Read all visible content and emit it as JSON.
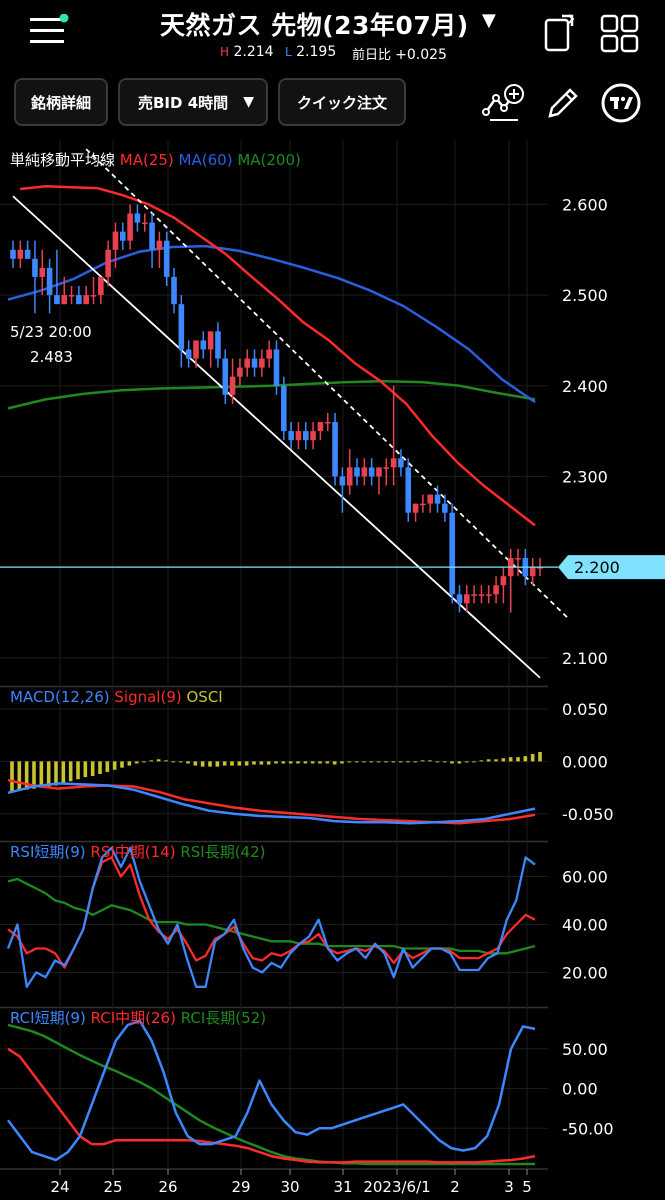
{
  "header": {
    "title": "天然ガス 先物(23年07月)",
    "high_label": "H",
    "high": "2.214",
    "low_label": "L",
    "low": "2.195",
    "change_label": "前日比",
    "change": "+0.025"
  },
  "toolbar": {
    "details_label": "銘柄詳細",
    "bid_label": "売BID 4時間",
    "quick_order_label": "クイック注文"
  },
  "icons": [
    "menu-icon",
    "rotate-screen-icon",
    "grid-icon",
    "add-drawing-icon",
    "pencil-icon",
    "tradingview-icon",
    "dropdown-caret-icon"
  ],
  "colors": {
    "up": "#e8414f",
    "down": "#3d87ff",
    "ma25": "#ff2a2a",
    "ma60": "#2a5fe0",
    "ma200": "#1e8a1e",
    "price_line": "#7fe3ff",
    "osci": "#c9c42d"
  },
  "chart_data": [
    {
      "type": "candlestick",
      "legend": [
        {
          "name": "単純移動平均線",
          "color": "#ffffff"
        },
        {
          "name": "MA(25)",
          "color": "#ff2a2a"
        },
        {
          "name": "MA(60)",
          "color": "#2a5fe0"
        },
        {
          "name": "MA(200)",
          "color": "#1e8a1e"
        }
      ],
      "annotation": {
        "date": "5/23 20:00",
        "value": "2.483"
      },
      "current_price": "2.200",
      "yticks": [
        "2.600",
        "2.500",
        "2.400",
        "2.300",
        "2.200",
        "2.100"
      ],
      "ylim": [
        2.07,
        2.66
      ],
      "xticks": [
        "24",
        "25",
        "26",
        "29",
        "30",
        "31",
        "2023/6/1",
        "2",
        "3",
        "5"
      ],
      "candles": [
        [
          2.55,
          2.56,
          2.53,
          2.54
        ],
        [
          2.54,
          2.56,
          2.53,
          2.55
        ],
        [
          2.55,
          2.56,
          2.54,
          2.54
        ],
        [
          2.54,
          2.56,
          2.48,
          2.52
        ],
        [
          2.52,
          2.55,
          2.5,
          2.53
        ],
        [
          2.53,
          2.54,
          2.48,
          2.5
        ],
        [
          2.5,
          2.55,
          2.49,
          2.49
        ],
        [
          2.49,
          2.52,
          2.49,
          2.5
        ],
        [
          2.5,
          2.51,
          2.49,
          2.5
        ],
        [
          2.5,
          2.51,
          2.49,
          2.49
        ],
        [
          2.49,
          2.51,
          2.49,
          2.5
        ],
        [
          2.5,
          2.52,
          2.49,
          2.5
        ],
        [
          2.5,
          2.52,
          2.49,
          2.52
        ],
        [
          2.52,
          2.56,
          2.51,
          2.55
        ],
        [
          2.55,
          2.58,
          2.53,
          2.57
        ],
        [
          2.57,
          2.58,
          2.55,
          2.56
        ],
        [
          2.56,
          2.6,
          2.55,
          2.59
        ],
        [
          2.59,
          2.6,
          2.57,
          2.58
        ],
        [
          2.58,
          2.59,
          2.57,
          2.58
        ],
        [
          2.58,
          2.59,
          2.53,
          2.55
        ],
        [
          2.55,
          2.57,
          2.53,
          2.56
        ],
        [
          2.56,
          2.57,
          2.51,
          2.52
        ],
        [
          2.52,
          2.53,
          2.48,
          2.49
        ],
        [
          2.49,
          2.5,
          2.42,
          2.44
        ],
        [
          2.44,
          2.45,
          2.42,
          2.43
        ],
        [
          2.43,
          2.45,
          2.42,
          2.45
        ],
        [
          2.45,
          2.46,
          2.43,
          2.44
        ],
        [
          2.44,
          2.46,
          2.42,
          2.46
        ],
        [
          2.46,
          2.47,
          2.42,
          2.43
        ],
        [
          2.43,
          2.44,
          2.38,
          2.39
        ],
        [
          2.39,
          2.43,
          2.38,
          2.41
        ],
        [
          2.41,
          2.43,
          2.4,
          2.42
        ],
        [
          2.42,
          2.44,
          2.41,
          2.43
        ],
        [
          2.43,
          2.44,
          2.41,
          2.42
        ],
        [
          2.42,
          2.44,
          2.41,
          2.43
        ],
        [
          2.43,
          2.45,
          2.42,
          2.44
        ],
        [
          2.44,
          2.45,
          2.39,
          2.4
        ],
        [
          2.4,
          2.41,
          2.34,
          2.35
        ],
        [
          2.35,
          2.36,
          2.33,
          2.34
        ],
        [
          2.34,
          2.36,
          2.33,
          2.35
        ],
        [
          2.35,
          2.36,
          2.33,
          2.34
        ],
        [
          2.34,
          2.36,
          2.33,
          2.35
        ],
        [
          2.35,
          2.36,
          2.34,
          2.36
        ],
        [
          2.36,
          2.37,
          2.35,
          2.36
        ],
        [
          2.36,
          2.37,
          2.29,
          2.3
        ],
        [
          2.3,
          2.31,
          2.26,
          2.29
        ],
        [
          2.29,
          2.33,
          2.28,
          2.31
        ],
        [
          2.31,
          2.32,
          2.29,
          2.3
        ],
        [
          2.3,
          2.32,
          2.29,
          2.31
        ],
        [
          2.31,
          2.32,
          2.29,
          2.3
        ],
        [
          2.3,
          2.31,
          2.28,
          2.31
        ],
        [
          2.31,
          2.32,
          2.29,
          2.31
        ],
        [
          2.31,
          2.4,
          2.29,
          2.32
        ],
        [
          2.32,
          2.33,
          2.3,
          2.31
        ],
        [
          2.31,
          2.32,
          2.25,
          2.26
        ],
        [
          2.26,
          2.27,
          2.25,
          2.27
        ],
        [
          2.27,
          2.28,
          2.26,
          2.27
        ],
        [
          2.27,
          2.28,
          2.26,
          2.28
        ],
        [
          2.28,
          2.29,
          2.26,
          2.27
        ],
        [
          2.27,
          2.28,
          2.25,
          2.26
        ],
        [
          2.26,
          2.27,
          2.16,
          2.17
        ],
        [
          2.17,
          2.18,
          2.15,
          2.16
        ],
        [
          2.16,
          2.18,
          2.15,
          2.17
        ],
        [
          2.17,
          2.18,
          2.16,
          2.17
        ],
        [
          2.17,
          2.18,
          2.16,
          2.17
        ],
        [
          2.17,
          2.18,
          2.16,
          2.17
        ],
        [
          2.17,
          2.19,
          2.16,
          2.18
        ],
        [
          2.18,
          2.2,
          2.16,
          2.19
        ],
        [
          2.19,
          2.22,
          2.15,
          2.21
        ],
        [
          2.21,
          2.22,
          2.19,
          2.21
        ],
        [
          2.21,
          2.22,
          2.18,
          2.19
        ],
        [
          2.19,
          2.21,
          2.18,
          2.2
        ],
        [
          2.2,
          2.21,
          2.19,
          2.2
        ]
      ],
      "ma25": [
        2.617,
        2.62,
        2.619,
        2.618,
        2.61,
        2.6,
        2.585,
        2.565,
        2.545,
        2.52,
        2.496,
        2.47,
        2.45,
        2.425,
        2.405,
        2.38,
        2.345,
        2.315,
        2.29,
        2.268,
        2.246
      ],
      "ma60": [
        2.495,
        2.505,
        2.518,
        2.536,
        2.548,
        2.553,
        2.554,
        2.549,
        2.54,
        2.53,
        2.519,
        2.505,
        2.488,
        2.465,
        2.44,
        2.407,
        2.382
      ],
      "ma200": [
        2.375,
        2.385,
        2.391,
        2.395,
        2.397,
        2.398,
        2.399,
        2.4,
        2.402,
        2.404,
        2.405,
        2.404,
        2.4,
        2.392,
        2.385
      ],
      "trendlines": [
        {
          "style": "solid",
          "from": [
            0,
            2.609
          ],
          "to": [
            72,
            2.078
          ]
        },
        {
          "style": "dashed",
          "from": [
            10,
            2.661
          ],
          "to": [
            76,
            2.142
          ]
        }
      ]
    },
    {
      "type": "bar",
      "legend": [
        {
          "name": "MACD(12,26)",
          "color": "#3d87ff"
        },
        {
          "name": "Signal(9)",
          "color": "#ff2a2a"
        },
        {
          "name": "OSCI",
          "color": "#c9c42d"
        }
      ],
      "yticks": [
        "0.050",
        "0.000",
        "-0.050"
      ],
      "ylim": [
        -0.075,
        0.07
      ],
      "macd": [
        -0.03,
        -0.024,
        -0.021,
        -0.022,
        -0.023,
        -0.027,
        -0.034,
        -0.041,
        -0.047,
        -0.05,
        -0.052,
        -0.053,
        -0.054,
        -0.057,
        -0.058,
        -0.058,
        -0.059,
        -0.058,
        -0.057,
        -0.055,
        -0.05,
        -0.045
      ],
      "signal": [
        -0.018,
        -0.023,
        -0.026,
        -0.024,
        -0.023,
        -0.024,
        -0.029,
        -0.036,
        -0.04,
        -0.044,
        -0.047,
        -0.049,
        -0.051,
        -0.053,
        -0.055,
        -0.056,
        -0.057,
        -0.058,
        -0.059,
        -0.057,
        -0.055,
        -0.051
      ],
      "osci": [
        -0.029,
        -0.028,
        -0.027,
        -0.026,
        -0.025,
        -0.024,
        -0.023,
        -0.021,
        -0.019,
        -0.017,
        -0.015,
        -0.014,
        -0.012,
        -0.01,
        -0.008,
        -0.006,
        -0.004,
        -0.002,
        0.0,
        0.001,
        0.002,
        0.001,
        0.0,
        0.0,
        -0.002,
        -0.004,
        -0.005,
        -0.005,
        -0.005,
        -0.004,
        -0.004,
        -0.004,
        -0.004,
        -0.003,
        -0.003,
        -0.003,
        -0.002,
        -0.002,
        -0.002,
        -0.002,
        -0.002,
        -0.002,
        -0.002,
        -0.002,
        -0.003,
        -0.002,
        -0.001,
        0.0,
        0.0,
        0.0,
        0.0,
        0.0,
        -0.001,
        -0.001,
        0.0,
        0.0,
        0.001,
        0.001,
        0.0,
        -0.001,
        -0.002,
        -0.002,
        -0.001,
        0.0,
        0.001,
        0.002,
        0.002,
        0.003,
        0.004,
        0.004,
        0.005,
        0.007,
        0.009
      ]
    },
    {
      "type": "line",
      "legend": [
        {
          "name": "RSI短期(9)",
          "color": "#3d87ff"
        },
        {
          "name": "RSI中期(14)",
          "color": "#ff2a2a"
        },
        {
          "name": "RSI長期(42)",
          "color": "#1e8a1e"
        }
      ],
      "yticks": [
        "60.00",
        "40.00",
        "20.00"
      ],
      "ylim": [
        6,
        74
      ],
      "short": [
        30,
        40,
        14,
        20,
        18,
        25,
        23,
        30,
        38,
        55,
        68,
        72,
        64,
        72,
        58,
        48,
        38,
        32,
        40,
        26,
        14,
        14,
        33,
        36,
        42,
        30,
        22,
        20,
        24,
        22,
        28,
        32,
        35,
        42,
        30,
        25,
        28,
        30,
        26,
        32,
        28,
        18,
        30,
        22,
        26,
        30,
        30,
        28,
        21,
        21,
        21,
        26,
        28,
        42,
        50,
        68,
        65
      ],
      "mid": [
        38,
        35,
        28,
        30,
        30,
        28,
        22,
        30,
        38,
        55,
        66,
        68,
        60,
        65,
        52,
        42,
        37,
        34,
        38,
        32,
        25,
        27,
        34,
        36,
        39,
        32,
        26,
        25,
        28,
        27,
        29,
        32,
        33,
        36,
        30,
        28,
        29,
        30,
        29,
        31,
        29,
        24,
        29,
        26,
        28,
        30,
        30,
        29,
        26,
        26,
        26,
        28,
        30,
        36,
        40,
        44,
        42
      ],
      "long": [
        58,
        59,
        57,
        55,
        53,
        50,
        49,
        47,
        46,
        44,
        46,
        48,
        47,
        46,
        44,
        42,
        41,
        41,
        41,
        40,
        40,
        40,
        39,
        38,
        37,
        36,
        35,
        34,
        33,
        33,
        33,
        32,
        32,
        32,
        31,
        31,
        31,
        31,
        31,
        31,
        31,
        31,
        30,
        30,
        30,
        30,
        30,
        30,
        29,
        29,
        29,
        28,
        28,
        28,
        29,
        30,
        31
      ]
    },
    {
      "type": "line",
      "legend": [
        {
          "name": "RCI短期(9)",
          "color": "#3d87ff"
        },
        {
          "name": "RCI中期(26)",
          "color": "#ff2a2a"
        },
        {
          "name": "RCI長期(52)",
          "color": "#1e8a1e"
        }
      ],
      "yticks": [
        "50.00",
        "0.00",
        "-50.00"
      ],
      "ylim": [
        -100,
        100
      ],
      "short": [
        -40,
        -60,
        -80,
        -85,
        -90,
        -80,
        -60,
        -20,
        20,
        60,
        80,
        85,
        60,
        20,
        -30,
        -60,
        -70,
        -70,
        -65,
        -60,
        -30,
        10,
        -20,
        -40,
        -55,
        -58,
        -50,
        -50,
        -45,
        -40,
        -35,
        -30,
        -25,
        -20,
        -35,
        -50,
        -65,
        -75,
        -78,
        -75,
        -60,
        -20,
        50,
        78,
        75
      ],
      "mid": [
        50,
        40,
        20,
        0,
        -20,
        -40,
        -60,
        -70,
        -70,
        -65,
        -65,
        -65,
        -65,
        -65,
        -65,
        -65,
        -66,
        -68,
        -70,
        -72,
        -75,
        -80,
        -85,
        -88,
        -90,
        -92,
        -93,
        -93,
        -93,
        -92,
        -92,
        -92,
        -92,
        -92,
        -92,
        -92,
        -93,
        -93,
        -93,
        -93,
        -92,
        -91,
        -90,
        -88,
        -85
      ],
      "long": [
        80,
        76,
        72,
        66,
        58,
        50,
        42,
        35,
        28,
        22,
        15,
        8,
        0,
        -10,
        -20,
        -30,
        -40,
        -48,
        -55,
        -62,
        -68,
        -74,
        -80,
        -85,
        -88,
        -90,
        -92,
        -93,
        -94,
        -94,
        -95,
        -95,
        -95,
        -95,
        -95,
        -95,
        -95,
        -95,
        -95,
        -95,
        -95,
        -95,
        -95,
        -95,
        -95
      ]
    }
  ]
}
